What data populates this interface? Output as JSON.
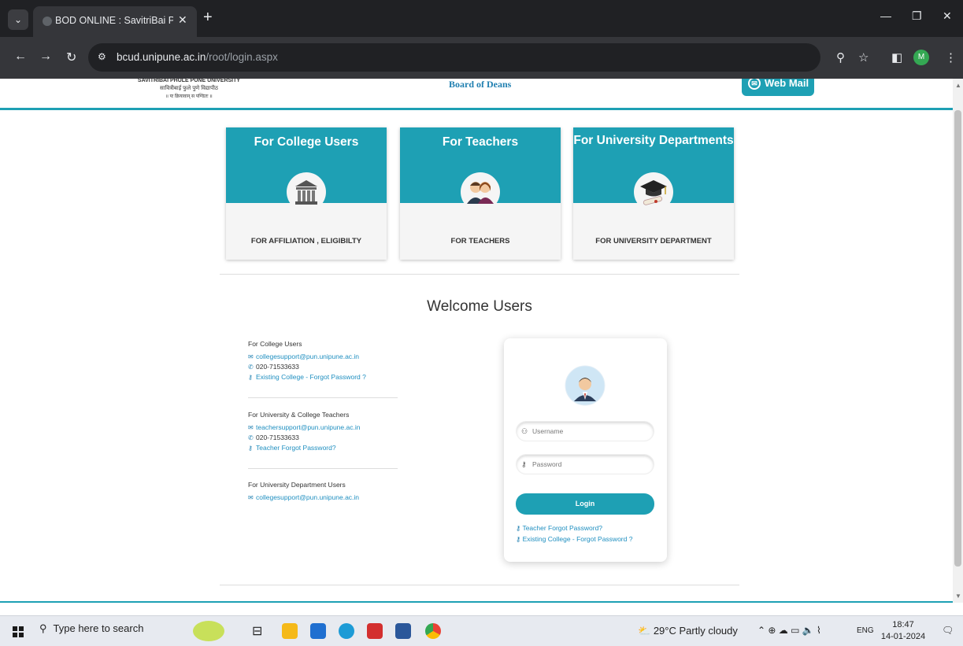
{
  "browser": {
    "tab_title": "BOD ONLINE : SavitriBai Phule P",
    "url_host": "bcud.unipune.ac.in",
    "url_path": "/root/login.aspx",
    "profile_initial": "M"
  },
  "header": {
    "logo_line1": "SAVITRIBAI PHULE PUNE UNIVERSITY",
    "logo_line2": "सावित्रीबाई फुले पुणे विद्यापीठ",
    "logo_line3": "॥ यः क्रियावान् स पण्डितः ॥",
    "board_title": "Board of Deans",
    "webmail_label": "Web Mail"
  },
  "cards": [
    {
      "title": "For College Users",
      "subtitle": "FOR AFFILIATION , ELIGIBILTY",
      "icon": "university-building-icon"
    },
    {
      "title": "For Teachers",
      "subtitle": "FOR TEACHERS",
      "icon": "teachers-icon"
    },
    {
      "title": "For University Departments",
      "subtitle": "FOR UNIVERSITY DEPARTMENT",
      "icon": "graduation-cap-icon"
    }
  ],
  "welcome": "Welcome Users",
  "contacts": {
    "college": {
      "heading": "For College Users",
      "email": "collegesupport@pun.unipune.ac.in",
      "phone": "020-71533633",
      "forgot": "Existing College - Forgot Password ?"
    },
    "teachers": {
      "heading": "For University & College Teachers",
      "email": "teachersupport@pun.unipune.ac.in",
      "phone": "020-71533633",
      "forgot": "Teacher Forgot Password?"
    },
    "department": {
      "heading": "For University Department Users",
      "email": "collegesupport@pun.unipune.ac.in"
    }
  },
  "login": {
    "username_placeholder": "Username",
    "password_placeholder": "Password",
    "button": "Login",
    "teacher_forgot": "Teacher Forgot Password?",
    "college_forgot": "Existing College - Forgot Password ?"
  },
  "taskbar": {
    "search_placeholder": "Type here to search",
    "weather": "29°C  Partly cloudy",
    "language": "ENG",
    "time": "18:47",
    "date": "14-01-2024"
  },
  "colors": {
    "accent": "#1ea0b4",
    "link": "#1f8fc0"
  }
}
